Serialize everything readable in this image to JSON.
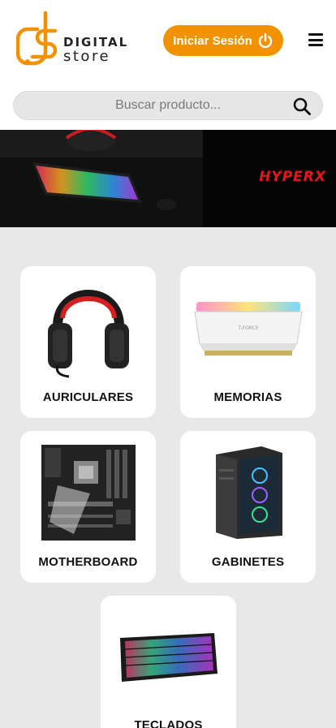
{
  "brand": {
    "name_top": "DIGITAL",
    "name_bottom": "store",
    "accent": "#f39200"
  },
  "header": {
    "login_label": "Iniciar Sesión",
    "login_icon": "power-icon",
    "menu_icon": "hamburger-menu-icon"
  },
  "search": {
    "placeholder": "Buscar producto...",
    "icon": "search-icon"
  },
  "banner": {
    "brand_text": "HYPERX",
    "brand_color": "#e8141c"
  },
  "categories": [
    {
      "label": "AURICULARES",
      "image": "headphones"
    },
    {
      "label": "MEMORIAS",
      "image": "ram-memory"
    },
    {
      "label": "MOTHERBOARD",
      "image": "motherboard"
    },
    {
      "label": "GABINETES",
      "image": "pc-case"
    },
    {
      "label": "TECLADOS",
      "image": "keyboard"
    }
  ]
}
